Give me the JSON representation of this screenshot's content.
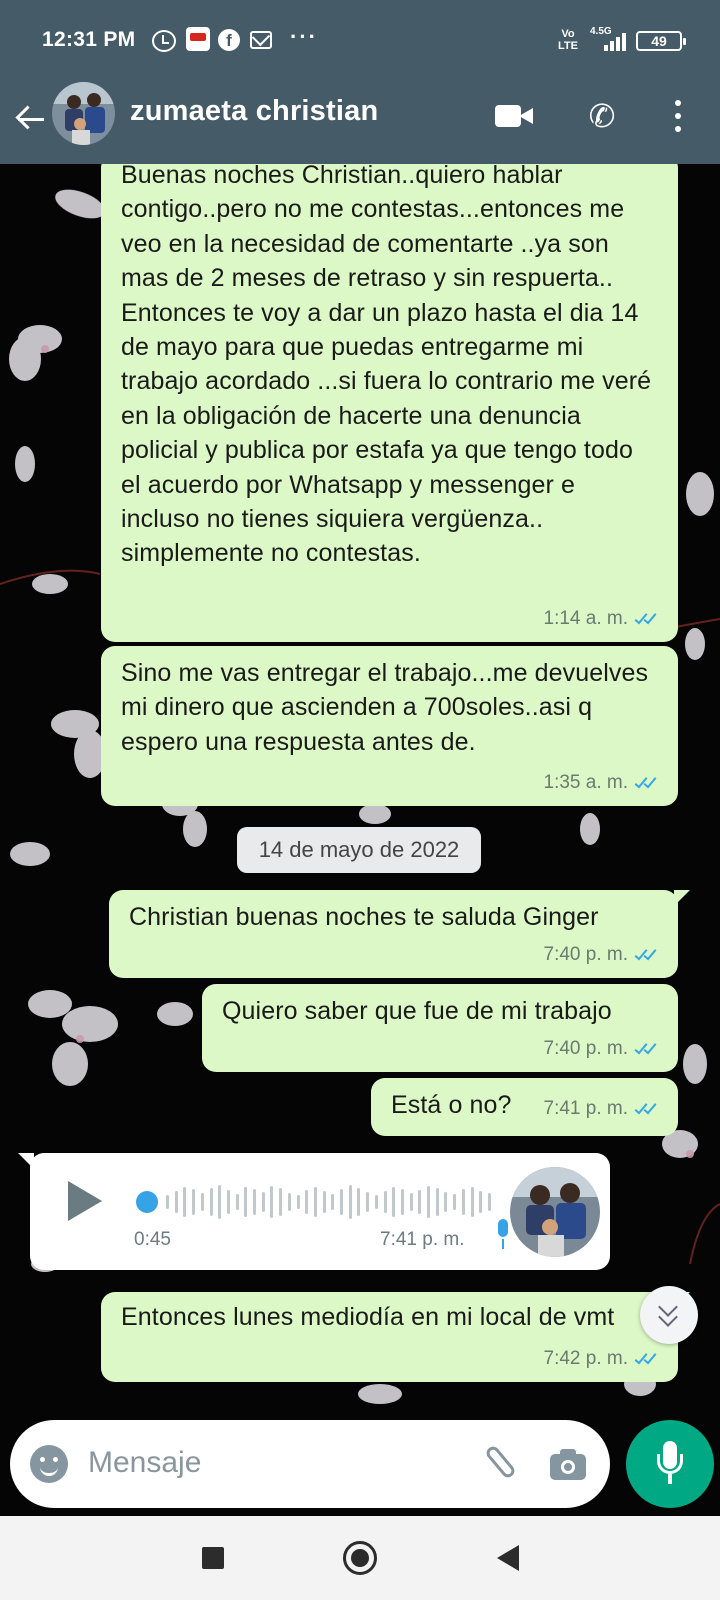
{
  "status_bar": {
    "time": "12:31 PM",
    "network": "Vo\nLTE",
    "network_gen": "4.5G",
    "battery": "49",
    "notification_icons": [
      "alarm-icon",
      "claro-video-icon",
      "facebook-icon",
      "gmail-icon",
      "more-dots-icon"
    ],
    "more": "···"
  },
  "header": {
    "contact_name": "zumaeta christian",
    "icons": [
      "back-arrow-icon",
      "video-call-icon",
      "phone-icon",
      "more-vert-icon"
    ]
  },
  "messages": [
    {
      "id": "m1",
      "direction": "outgoing",
      "text": "Buenas noches Christian..quiero hablar contigo..pero no me contestas...entonces me veo en la necesidad de comentarte ..ya son mas de 2 meses de retraso y sin respuerta..\nEntonces te voy a dar un plazo hasta el dia 14 de mayo para que puedas entregarme mi trabajo acordado ...si fuera lo contrario me veré en la obligación de hacerte una denuncia policial y publica por estafa ya que tengo todo el acuerdo por Whatsapp y messenger e incluso no tienes siquiera vergüenza.. simplemente no contestas.",
      "time": "1:14 a. m.",
      "status": "read"
    },
    {
      "id": "m2",
      "direction": "outgoing",
      "text": "Sino me vas entregar el trabajo...me devuelves mi dinero que ascienden a 700soles..asi q espero una respuesta antes de.",
      "time": "1:35 a. m.",
      "status": "read"
    },
    {
      "id": "date1",
      "type": "date_separator",
      "text": "14 de mayo de 2022"
    },
    {
      "id": "m3",
      "direction": "outgoing",
      "text": "Christian buenas noches te saluda Ginger",
      "time": "7:40 p. m.",
      "status": "read"
    },
    {
      "id": "m4",
      "direction": "outgoing",
      "text": "Quiero saber que fue de mi trabajo",
      "time": "7:40 p. m.",
      "status": "read"
    },
    {
      "id": "m5",
      "direction": "outgoing",
      "text": "Está o no?",
      "time": "7:41 p. m.",
      "status": "read"
    },
    {
      "id": "v1",
      "direction": "incoming",
      "type": "voice",
      "duration": "0:45",
      "time": "7:41 p. m.",
      "progress": 0
    },
    {
      "id": "m6",
      "direction": "outgoing",
      "text": "Entonces lunes mediodía en mi local de vmt",
      "time": "7:42 p. m.",
      "status": "read"
    }
  ],
  "composer": {
    "placeholder": "Mensaje",
    "icons": [
      "emoji-icon",
      "attach-icon",
      "camera-icon",
      "mic-icon"
    ]
  },
  "nav_bar": {
    "icons": [
      "recents-icon",
      "home-icon",
      "back-icon"
    ]
  },
  "colors": {
    "header_bg": "#455c68",
    "outgoing_bubble": "#dcf8c6",
    "incoming_bubble": "#ffffff",
    "read_ticks": "#34a7e8",
    "mic_button": "#00a884"
  }
}
